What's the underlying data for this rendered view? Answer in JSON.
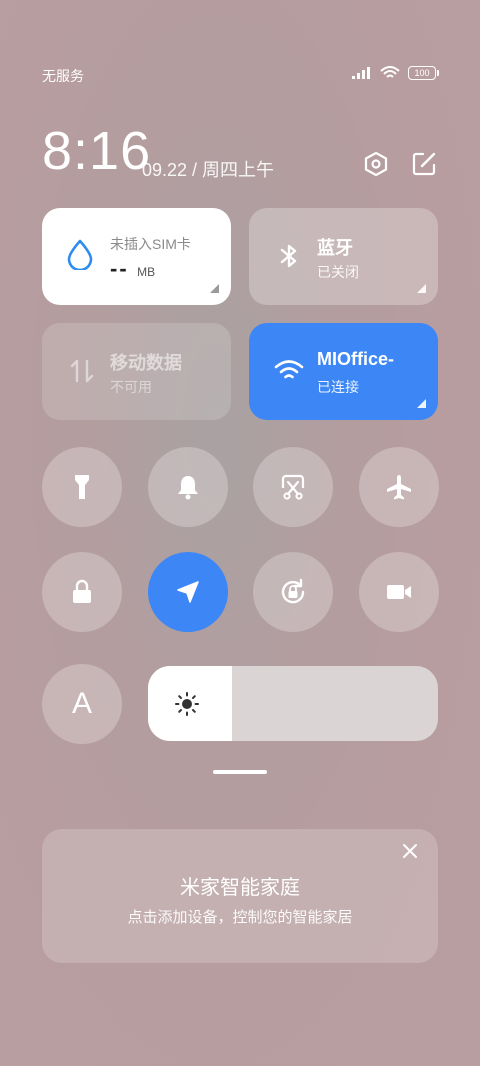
{
  "status_bar": {
    "carrier": "无服务",
    "battery": "100",
    "icons": [
      "signal-icon",
      "wifi-icon",
      "battery-icon"
    ]
  },
  "header": {
    "time": "8:16",
    "date": "09.22 / 周四上午",
    "icons": [
      "settings-icon",
      "edit-icon"
    ]
  },
  "tiles": {
    "data_usage": {
      "title": "未插入SIM卡",
      "value": "--",
      "unit": "MB",
      "icon": "drop-icon"
    },
    "bluetooth": {
      "title": "蓝牙",
      "status": "已关闭",
      "icon": "bluetooth-icon"
    },
    "mobile_data": {
      "title": "移动数据",
      "status": "不可用",
      "icon": "mobile-data-icon"
    },
    "wifi": {
      "title": "MIOffice-",
      "status": "已连接",
      "icon": "wifi-icon",
      "color": "#3c86f5"
    }
  },
  "toggles_row1": [
    "flashlight-icon",
    "bell-icon",
    "screenshot-icon",
    "airplane-icon"
  ],
  "toggles_row2": [
    "lock-icon",
    "location-icon",
    "rotation-lock-icon",
    "video-icon"
  ],
  "font_button": {
    "label": "A"
  },
  "brightness": {
    "level": 0.29,
    "icon": "sun-icon"
  },
  "smart_home_card": {
    "title": "米家智能家庭",
    "subtitle": "点击添加设备，控制您的智能家居"
  },
  "colors": {
    "accent": "#3c86f5"
  }
}
